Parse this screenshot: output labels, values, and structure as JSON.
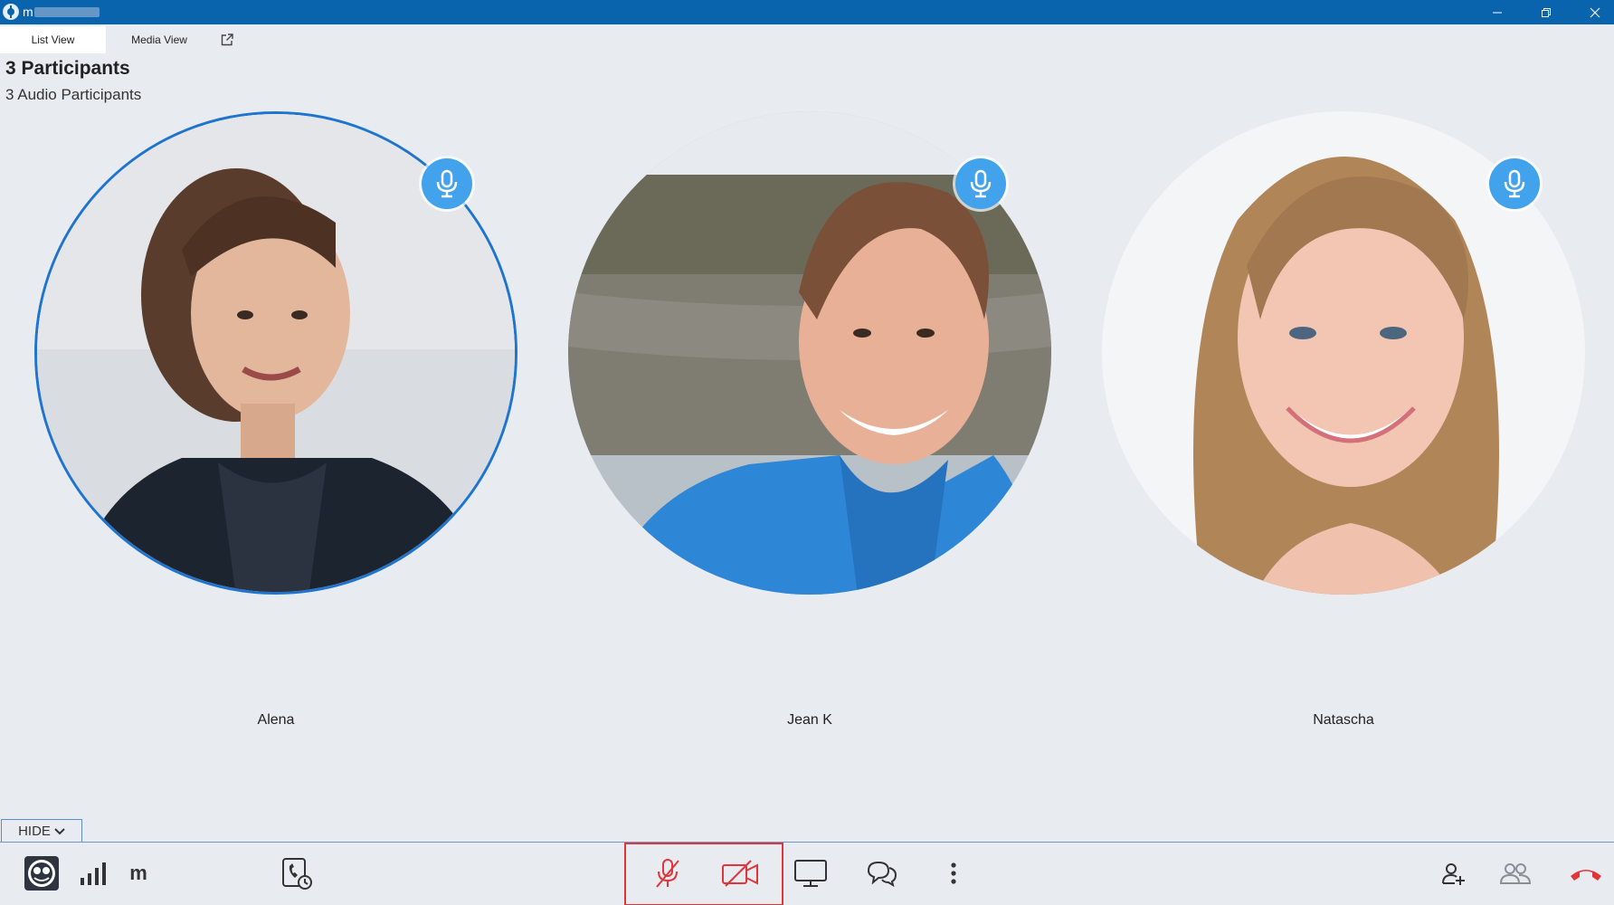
{
  "window": {
    "title": "m",
    "icon": "app-globe-icon"
  },
  "tabs": {
    "list_view": "List View",
    "media_view": "Media View"
  },
  "participants_header": {
    "count_label": "3 Participants",
    "audio_label": "3 Audio Participants"
  },
  "participants": [
    {
      "name": "Alena",
      "speaking": true
    },
    {
      "name": "Jean K",
      "speaking": false
    },
    {
      "name": "Natascha",
      "speaking": false
    }
  ],
  "toolbar": {
    "hide_label": "HIDE",
    "user_initial": "m"
  },
  "colors": {
    "titlebar": "#0a64ad",
    "accent": "#1f74d0",
    "mic_badge": "#42a3ec",
    "muted_red": "#e0353b",
    "hangup": "#e0353b"
  }
}
